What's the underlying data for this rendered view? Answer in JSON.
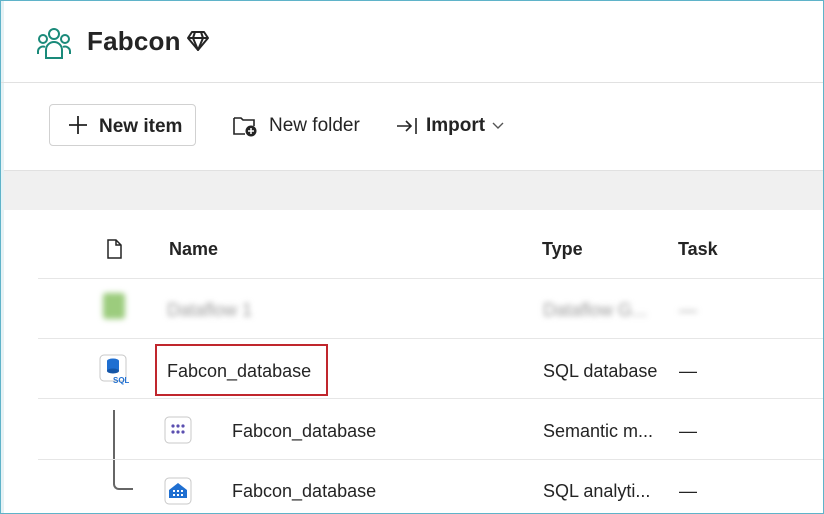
{
  "workspace": {
    "title": "Fabcon"
  },
  "toolbar": {
    "new_item_label": "New item",
    "new_folder_label": "New folder",
    "import_label": "Import"
  },
  "table": {
    "headers": {
      "name": "Name",
      "type": "Type",
      "task": "Task"
    },
    "rows": [
      {
        "name": "Dataflow 1",
        "type": "Dataflow G...",
        "task": "—",
        "icon": "dataflow-icon",
        "blurred": true
      },
      {
        "name": "Fabcon_database",
        "type": "SQL database",
        "task": "—",
        "icon": "sql-database-icon",
        "highlighted": true
      },
      {
        "name": "Fabcon_database",
        "type": "Semantic m...",
        "task": "—",
        "icon": "semantic-model-icon",
        "child": true
      },
      {
        "name": "Fabcon_database",
        "type": "SQL analyti...",
        "task": "—",
        "icon": "sql-analytics-endpoint-icon",
        "child": true
      }
    ]
  },
  "colors": {
    "highlight": "#c0262d",
    "workspace_icon": "#1a8a7a",
    "sql_icon": "#1f6fd1",
    "semantic_icon": "#5b4fb0"
  }
}
